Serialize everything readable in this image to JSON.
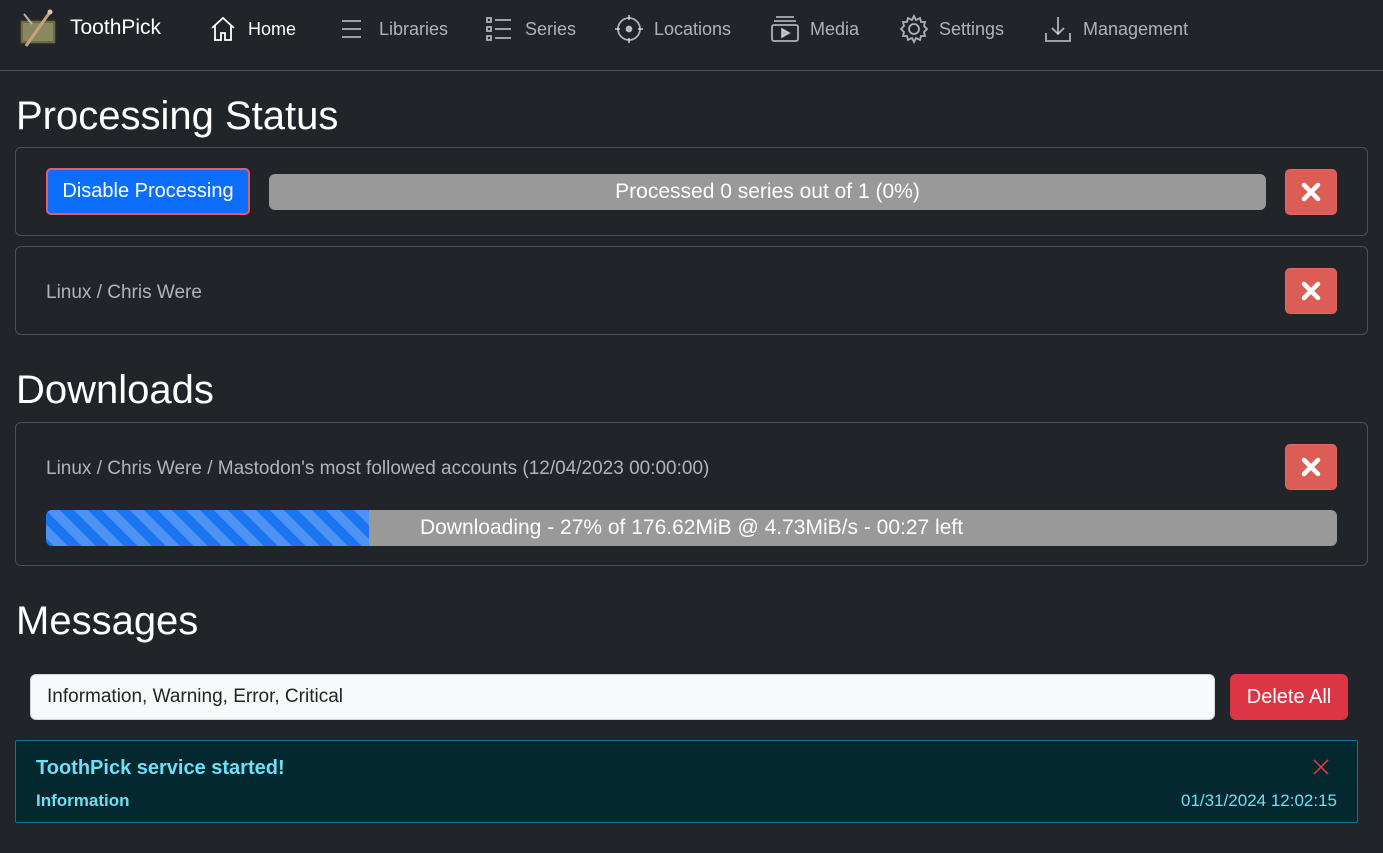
{
  "app": {
    "brand": "ToothPick"
  },
  "nav": {
    "items": [
      {
        "label": "Home",
        "icon": "house-icon"
      },
      {
        "label": "Libraries",
        "icon": "list-icon"
      },
      {
        "label": "Series",
        "icon": "list-task-icon"
      },
      {
        "label": "Locations",
        "icon": "crosshair-icon"
      },
      {
        "label": "Media",
        "icon": "collection-play-icon"
      },
      {
        "label": "Settings",
        "icon": "gear-icon"
      },
      {
        "label": "Management",
        "icon": "download-icon"
      }
    ],
    "active": "Home"
  },
  "processing": {
    "title": "Processing Status",
    "toggle_label": "Disable Processing",
    "progress_label": "Processed 0 series out of 1 (0%)",
    "progress_fraction": 0,
    "current_item": "Linux / Chris Were"
  },
  "downloads": {
    "title": "Downloads",
    "items": [
      {
        "name": "Linux / Chris Were / Mastodon's most followed accounts (12/04/2023 00:00:00)",
        "progress_label": "Downloading - 27% of 176.62MiB @ 4.73MiB/s - 00:27 left",
        "progress_percent": 25
      }
    ]
  },
  "messages": {
    "title": "Messages",
    "filter_value": "Information, Warning, Error, Critical",
    "delete_all_label": "Delete All",
    "items": [
      {
        "title": "ToothPick service started!",
        "level": "Information",
        "timestamp": "01/31/2024 12:02:15"
      }
    ]
  },
  "colors": {
    "background": "#212529",
    "primary": "#0d6efd",
    "danger": "#dc3545",
    "close_button": "#dc5c56",
    "info_text": "#6edff6",
    "info_bg": "#032830"
  }
}
